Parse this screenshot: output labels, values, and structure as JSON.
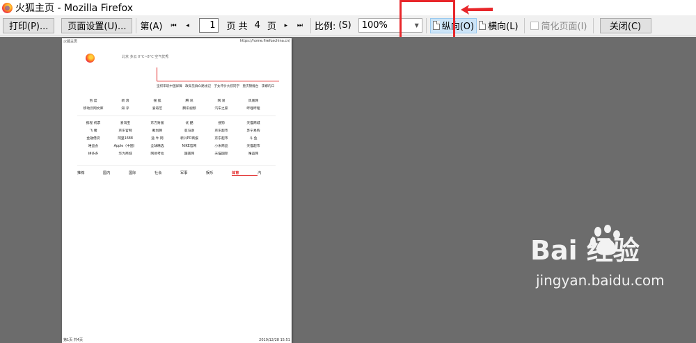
{
  "window": {
    "title": "火狐主页 - Mozilla Firefox"
  },
  "toolbar": {
    "print_label": "打印(P)...",
    "page_setup_label": "页面设置(U)...",
    "page_prefix": "第(A)",
    "first_icon": "⏮",
    "prev_icon": "◂",
    "current_page": "1",
    "page_suffix": "页 共",
    "total_pages": "4",
    "page_unit": "页",
    "next_icon": "▸",
    "last_icon": "⏭",
    "scale_label": "比例:",
    "scale_key": "(S)",
    "scale_value": "100%",
    "portrait_label": "纵向(O)",
    "landscape_label": "横向(L)",
    "simplify_label": "简化页面(I)",
    "close_label": "关闭(C)"
  },
  "annotation": {
    "color": "#e8262a"
  },
  "preview_page": {
    "header_left": "火狐主页",
    "header_right": "https://home.firefoxchina.cn/",
    "weather": "北京  多云 0°C~8°C    空气优秀",
    "hot_links": [
      "坚织牢筑中国屏障",
      "政知见群众路线记",
      "子女评价大叔同学",
      "重庆锦鲤台",
      "李娜的口"
    ],
    "grid_a": [
      [
        "百 度",
        "新 浪",
        "搜 狐",
        "腾 讯",
        "网 易",
        "凤凰网"
      ],
      [
        "移动云网文库",
        "知 乎",
        "爱奇艺",
        "腾讯视频",
        "汽车之家",
        "哔哩哔哩"
      ]
    ],
    "grid_b": [
      [
        "携程 机票",
        "爱淘宝",
        "东方财富",
        "优 酷",
        "搜狗",
        "天猫商城"
      ],
      [
        "飞 猪",
        "京东官网",
        "聚划算",
        "亚马逊",
        "京东超市",
        "苏宁易购"
      ],
      [
        "金融借贷",
        "阿里1688",
        "途 牛 网",
        "新兴PO商报",
        "京东超市",
        "斗 鱼"
      ],
      [
        "唯品会",
        "Apple（中国）",
        "全球精选",
        "NIKE官网",
        "小米商品",
        "天猫超市"
      ],
      [
        "拼多多",
        "华为商城",
        "网易考拉",
        "国美网",
        "天猫国际",
        "唯品网"
      ]
    ],
    "news_tabs": [
      "推荐",
      "国内",
      "国际",
      "社会",
      "军事",
      "娱乐",
      "体育",
      "汽"
    ],
    "news_active": "体育",
    "footer_left": "第1页 共4页",
    "footer_right": "2019/12/28 15:51"
  },
  "watermark": {
    "brand": "Bai  经验",
    "url": "jingyan.baidu.com"
  }
}
